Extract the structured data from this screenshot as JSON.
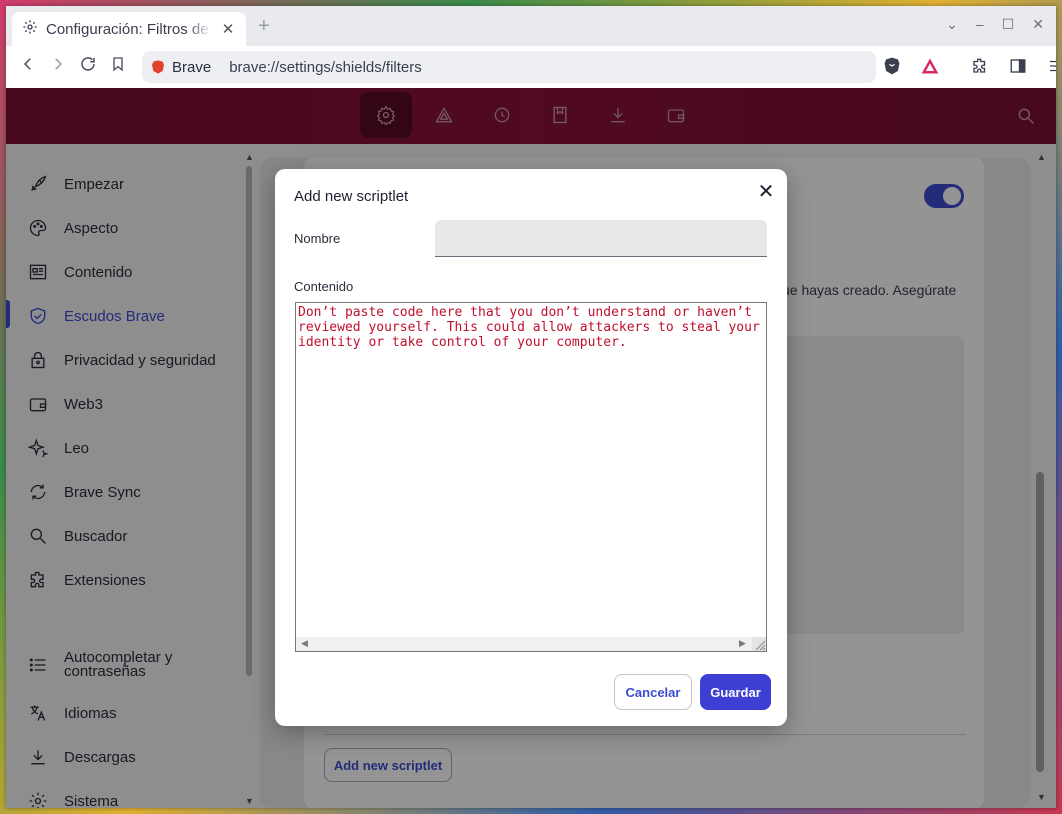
{
  "browser": {
    "tab_title": "Configuración: Filtros de contenido",
    "tab_close": "✕",
    "new_tab": "+",
    "brand_label": "Brave",
    "url": "brave://settings/shields/filters"
  },
  "sidebar": {
    "items": [
      {
        "label": "Empezar",
        "icon": "rocket-icon"
      },
      {
        "label": "Aspecto",
        "icon": "palette-icon"
      },
      {
        "label": "Contenido",
        "icon": "content-icon"
      },
      {
        "label": "Escudos Brave",
        "icon": "shield-icon"
      },
      {
        "label": "Privacidad y seguridad",
        "icon": "lock-icon"
      },
      {
        "label": "Web3",
        "icon": "wallet-icon"
      },
      {
        "label": "Leo",
        "icon": "sparkle-icon"
      },
      {
        "label": "Brave Sync",
        "icon": "sync-icon"
      },
      {
        "label": "Buscador",
        "icon": "search-icon"
      },
      {
        "label": "Extensiones",
        "icon": "puzzle-icon"
      },
      {
        "label": "Autocompletar y contraseñas",
        "icon": "list-icon"
      },
      {
        "label": "Idiomas",
        "icon": "translate-icon"
      },
      {
        "label": "Descargas",
        "icon": "download-icon"
      },
      {
        "label": "Sistema",
        "icon": "gear-icon"
      }
    ],
    "active_index": 3
  },
  "background": {
    "description_fragment": "ue hayas creado. Asegúrate",
    "add_scriptlet_label": "Add new scriptlet"
  },
  "dialog": {
    "title": "Add new scriptlet",
    "close": "✕",
    "name_label": "Nombre",
    "name_value": "",
    "content_label": "Contenido",
    "content_text": "Don’t paste code here that you don’t understand or haven’t reviewed yourself. This could allow attackers to steal your identity or take control of your computer.",
    "cancel_label": "Cancelar",
    "save_label": "Guardar"
  },
  "colors": {
    "accent": "#3d4bd4",
    "header": "#8c1238",
    "warning_text": "#c0102e"
  }
}
